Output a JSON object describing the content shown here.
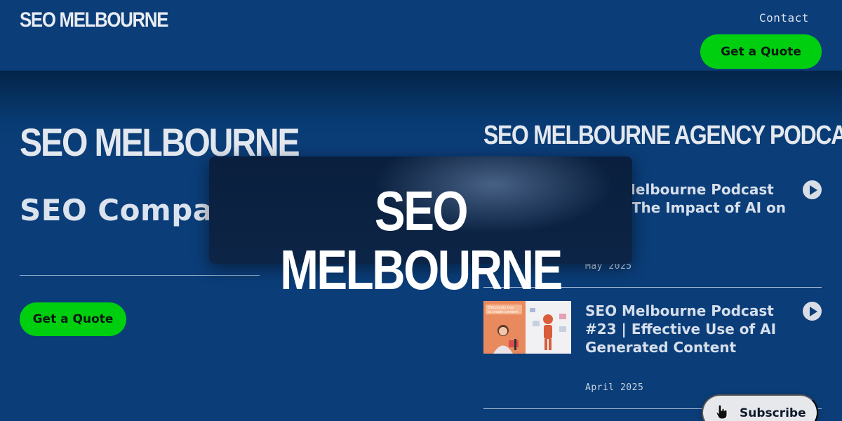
{
  "header": {
    "logo": "SEO MELBOURNE",
    "nav_contact": "Contact",
    "cta": "Get a Quote"
  },
  "hero": {
    "logo": "SEO MELBOURNE",
    "title": "SEO Company Melbourne",
    "cta": "Get a Quote"
  },
  "podcast": {
    "heading": "SEO MELBOURNE AGENCY PODCAST",
    "episodes": [
      {
        "title": "SEO Melbourne Podcast #24 | The Impact of AI on SEO",
        "date": "May 2025",
        "thumb_text": ""
      },
      {
        "title": "SEO Melbourne Podcast #23 | Effective Use of AI Generated Content",
        "date": "April 2025",
        "thumb_text": "Effectively Use AI to create content"
      }
    ]
  },
  "overlay": {
    "logo": "SEO MELBOURNE"
  },
  "subscribe": {
    "label": "Subscribe"
  },
  "colors": {
    "background": "#0b3d78",
    "accent_green": "#00cf10",
    "text_light": "#dbe3ee",
    "overlay_bg": "#0a1f3d"
  },
  "icons": {
    "play": "play-icon",
    "cursor": "hand-cursor-icon"
  }
}
